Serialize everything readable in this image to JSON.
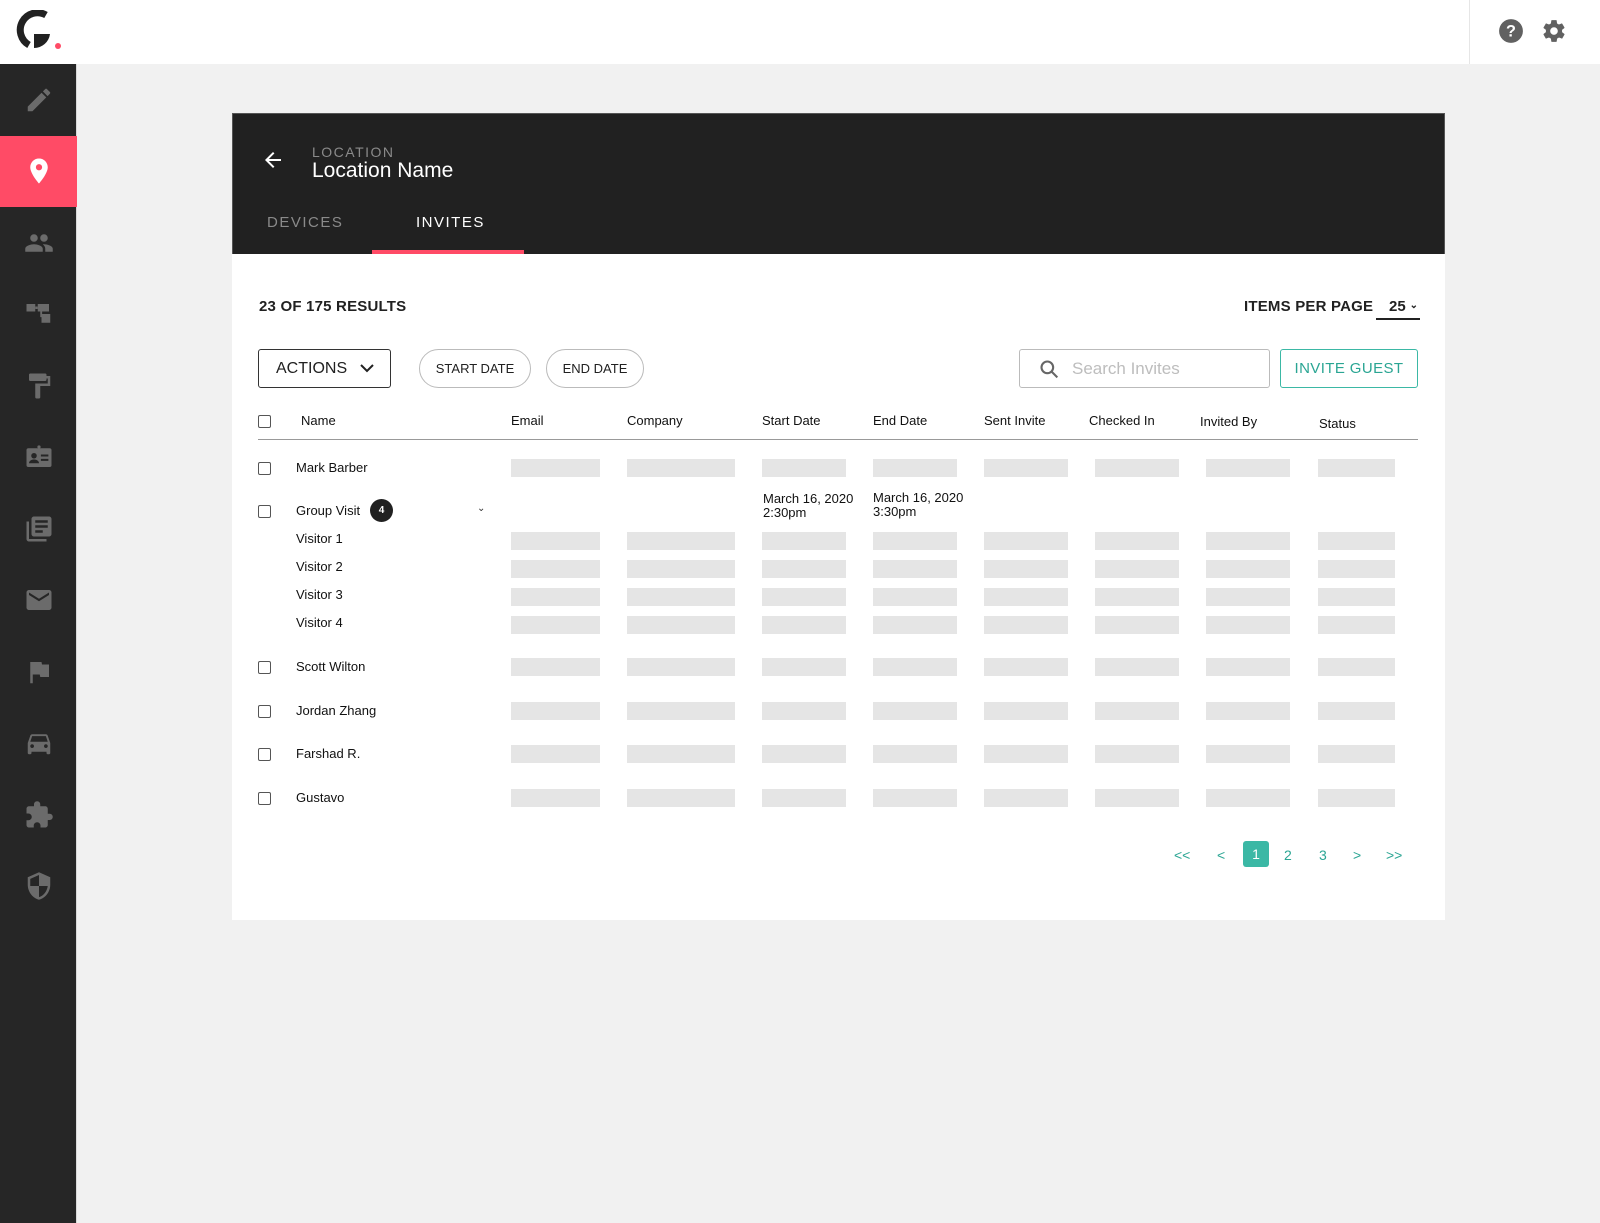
{
  "topbar": {
    "logo": "G-logo",
    "icons": [
      {
        "name": "help-icon"
      },
      {
        "name": "gear-icon"
      }
    ]
  },
  "sidebar": {
    "accent": "#ff4b66",
    "items": [
      {
        "name": "edit",
        "icon": "pencil-icon",
        "active": false
      },
      {
        "name": "locations",
        "icon": "location-pin-icon",
        "active": true
      },
      {
        "name": "users",
        "icon": "people-icon",
        "active": false
      },
      {
        "name": "hierarchy",
        "icon": "hierarchy-icon",
        "active": false
      },
      {
        "name": "branding",
        "icon": "paint-roller-icon",
        "active": false
      },
      {
        "name": "badges",
        "icon": "id-badge-icon",
        "active": false
      },
      {
        "name": "documents",
        "icon": "library-books-icon",
        "active": false
      },
      {
        "name": "messages",
        "icon": "mail-icon",
        "active": false
      },
      {
        "name": "reports",
        "icon": "flag-icon",
        "active": false
      },
      {
        "name": "parking",
        "icon": "car-icon",
        "active": false
      },
      {
        "name": "integrations",
        "icon": "puzzle-icon",
        "active": false
      },
      {
        "name": "security",
        "icon": "shield-icon",
        "active": false
      }
    ]
  },
  "header": {
    "label": "LOCATION",
    "title": "Location Name",
    "tabs": [
      {
        "label": "DEVICES",
        "active": false
      },
      {
        "label": "INVITES",
        "active": true
      }
    ]
  },
  "toolbar": {
    "results": "23 OF 175 RESULTS",
    "items_per_page_label": "ITEMS PER PAGE",
    "items_per_page_value": "25",
    "actions_label": "ACTIONS",
    "start_date_label": "START DATE",
    "end_date_label": "END DATE",
    "search_placeholder": "Search Invites",
    "invite_guest_label": "INVITE GUEST",
    "accent": "#3bb8a5"
  },
  "table": {
    "columns": [
      "Name",
      "Email",
      "Company",
      "Start Date",
      "End Date",
      "Sent Invite",
      "Checked In",
      "Invited By",
      "Status"
    ],
    "rows": [
      {
        "name": "Mark Barber"
      },
      {
        "name": "Group Visit",
        "count": "4",
        "start_date": "March 16, 2020",
        "start_time": "2:30pm",
        "end_date": "March 16, 2020",
        "end_time": "3:30pm",
        "visitors": [
          "Visitor 1",
          "Visitor 2",
          "Visitor 3",
          "Visitor 4"
        ]
      },
      {
        "name": "Scott Wilton"
      },
      {
        "name": "Jordan Zhang"
      },
      {
        "name": "Farshad R."
      },
      {
        "name": "Gustavo"
      }
    ]
  },
  "pagination": {
    "first": "<<",
    "prev": "<",
    "pages": [
      "1",
      "2",
      "3"
    ],
    "current": "1",
    "next": ">",
    "last": ">>"
  }
}
